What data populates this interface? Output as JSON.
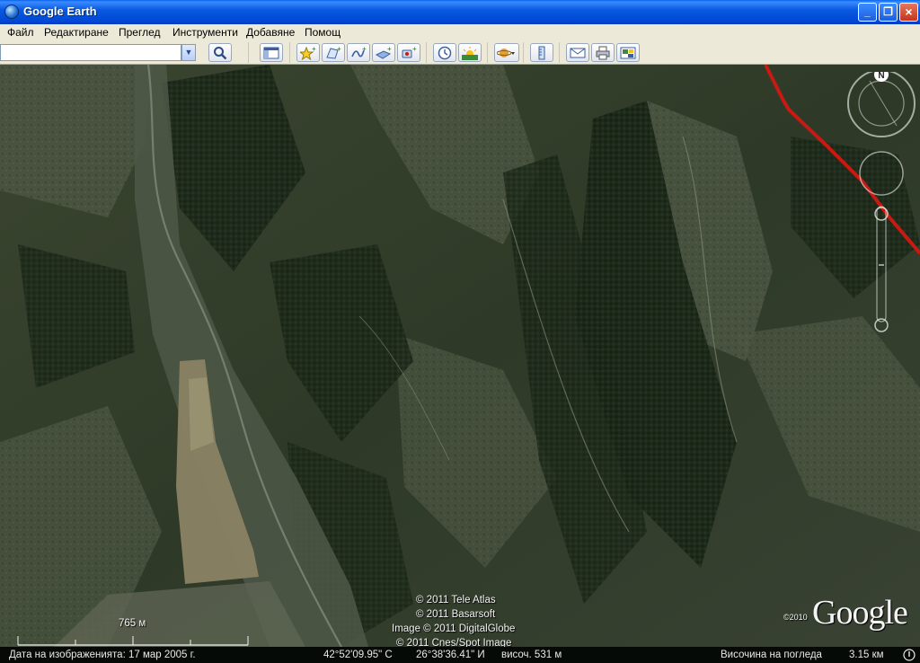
{
  "window": {
    "title": "Google Earth"
  },
  "menu": [
    "Файл",
    "Редактиране",
    "Преглед",
    "Инструменти",
    "Добавяне",
    "Помощ"
  ],
  "search": {
    "value": "",
    "placeholder": ""
  },
  "toolbar_icons": [
    "search-icon",
    "sidebar-toggle-icon",
    "placemark-icon",
    "polygon-icon",
    "path-icon",
    "image-overlay-icon",
    "record-tour-icon",
    "historical-imagery-icon",
    "sunlight-icon",
    "planets-icon",
    "ruler-icon",
    "email-icon",
    "print-icon",
    "save-image-icon"
  ],
  "map": {
    "scale_label": "765 м",
    "copyright": [
      "© 2011 Tele Atlas",
      "© 2011 Basarsoft",
      "Image © 2011 DigitalGlobe",
      "© 2011 Cnes/Spot Image"
    ],
    "logo_year": "©2010",
    "logo_text": "Google",
    "compass_north": "N"
  },
  "status": {
    "imagery_date": "Дата на изображенията: 17 мар 2005 г.",
    "latitude": "42°52'09.95\" С",
    "longitude": "26°38'36.41\" И",
    "elevation": "височ.  531 м",
    "eye_altitude_label": "Височина на погледа",
    "eye_altitude_value": "3.15 км"
  },
  "colors": {
    "road": "#c81a12",
    "titlebar": "#0a5ae0",
    "chrome": "#ece9d8"
  }
}
